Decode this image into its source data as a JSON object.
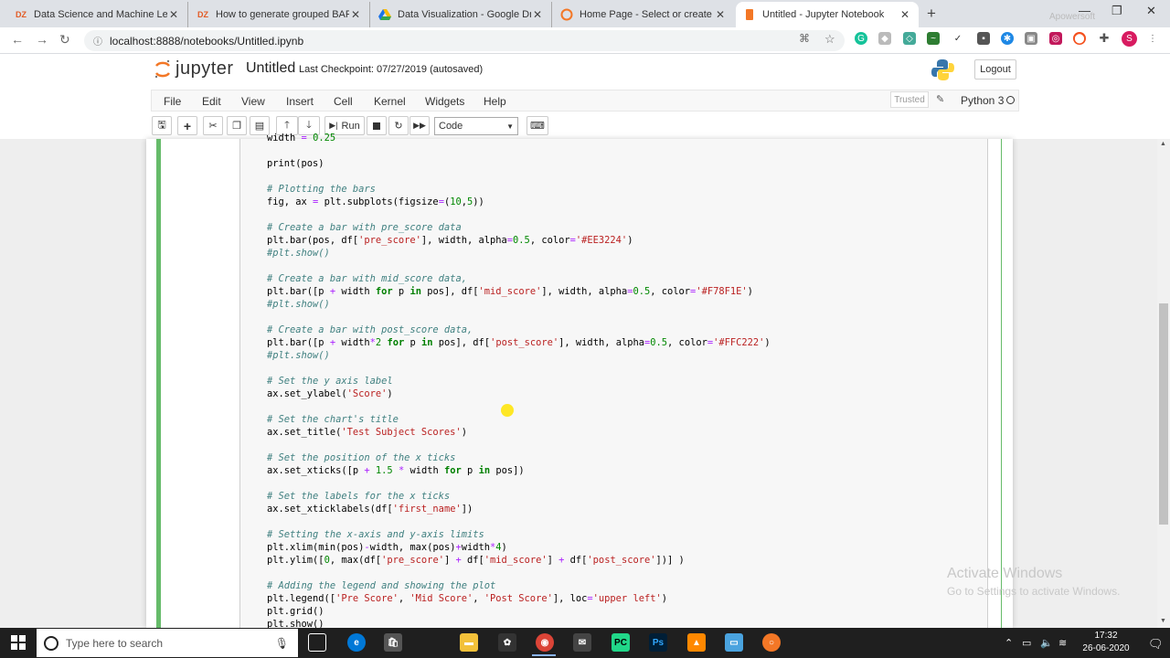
{
  "browser": {
    "tabs": [
      {
        "label": "Data Science and Machine Learni",
        "icon": "dzone-icon"
      },
      {
        "label": "How to generate grouped BAR pl",
        "icon": "dzone-icon"
      },
      {
        "label": "Data Visualization - Google Drive",
        "icon": "google-drive-icon"
      },
      {
        "label": "Home Page - Select or create a n",
        "icon": "jupyter-icon"
      },
      {
        "label": "Untitled - Jupyter Notebook",
        "icon": "jupyter-icon",
        "active": true
      }
    ],
    "url": "localhost:8888/notebooks/Untitled.ipynb",
    "recorder_watermark": "Apowersoft"
  },
  "jupyter": {
    "brand": "jupyter",
    "notebook_name": "Untitled",
    "checkpoint": "Last Checkpoint: 07/27/2019  (autosaved)",
    "logout": "Logout",
    "menu": [
      "File",
      "Edit",
      "View",
      "Insert",
      "Cell",
      "Kernel",
      "Widgets",
      "Help"
    ],
    "trusted": "Trusted",
    "kernel": "Python 3",
    "toolbar": {
      "run_label": "Run",
      "cell_type": "Code"
    }
  },
  "code_lines": [
    {
      "t": "width = 0.25",
      "k": "code"
    },
    {
      "t": "",
      "k": "blank"
    },
    {
      "t": "print(pos)",
      "k": "code"
    },
    {
      "t": "",
      "k": "blank"
    },
    {
      "t": "# Plotting the bars",
      "k": "comment"
    },
    {
      "t": "fig, ax = plt.subplots(figsize=(10,5))",
      "k": "code"
    },
    {
      "t": "",
      "k": "blank"
    },
    {
      "t": "# Create a bar with pre_score data",
      "k": "comment"
    },
    {
      "t": "plt.bar(pos, df['pre_score'], width, alpha=0.5, color='#EE3224')",
      "k": "code"
    },
    {
      "t": "#plt.show()",
      "k": "comment"
    },
    {
      "t": "",
      "k": "blank"
    },
    {
      "t": "# Create a bar with mid_score data,",
      "k": "comment"
    },
    {
      "t": "plt.bar([p + width for p in pos], df['mid_score'], width, alpha=0.5, color='#F78F1E')",
      "k": "code"
    },
    {
      "t": "#plt.show()",
      "k": "comment"
    },
    {
      "t": "",
      "k": "blank"
    },
    {
      "t": "# Create a bar with post_score data,",
      "k": "comment"
    },
    {
      "t": "plt.bar([p + width*2 for p in pos], df['post_score'], width, alpha=0.5, color='#FFC222')",
      "k": "code"
    },
    {
      "t": "#plt.show()",
      "k": "comment"
    },
    {
      "t": "",
      "k": "blank"
    },
    {
      "t": "# Set the y axis label",
      "k": "comment"
    },
    {
      "t": "ax.set_ylabel('Score')",
      "k": "code"
    },
    {
      "t": "",
      "k": "blank"
    },
    {
      "t": "# Set the chart's title",
      "k": "comment"
    },
    {
      "t": "ax.set_title('Test Subject Scores')",
      "k": "code"
    },
    {
      "t": "",
      "k": "blank"
    },
    {
      "t": "# Set the position of the x ticks",
      "k": "comment"
    },
    {
      "t": "ax.set_xticks([p + 1.5 * width for p in pos])",
      "k": "code"
    },
    {
      "t": "",
      "k": "blank"
    },
    {
      "t": "# Set the labels for the x ticks",
      "k": "comment"
    },
    {
      "t": "ax.set_xticklabels(df['first_name'])",
      "k": "code"
    },
    {
      "t": "",
      "k": "blank"
    },
    {
      "t": "# Setting the x-axis and y-axis limits",
      "k": "comment"
    },
    {
      "t": "plt.xlim(min(pos)-width, max(pos)+width*4)",
      "k": "code"
    },
    {
      "t": "plt.ylim([0, max(df['pre_score'] + df['mid_score'] + df['post_score'])] )",
      "k": "code"
    },
    {
      "t": "",
      "k": "blank"
    },
    {
      "t": "# Adding the legend and showing the plot",
      "k": "comment"
    },
    {
      "t": "plt.legend(['Pre Score', 'Mid Score', 'Post Score'], loc='upper left')",
      "k": "code"
    },
    {
      "t": "plt.grid()",
      "k": "code"
    },
    {
      "t": "plt.show()",
      "k": "code"
    }
  ],
  "watermark": {
    "line1": "Activate Windows",
    "line2": "Go to Settings to activate Windows."
  },
  "taskbar": {
    "search_placeholder": "Type here to search",
    "time": "17:32",
    "date": "26-06-2020"
  }
}
